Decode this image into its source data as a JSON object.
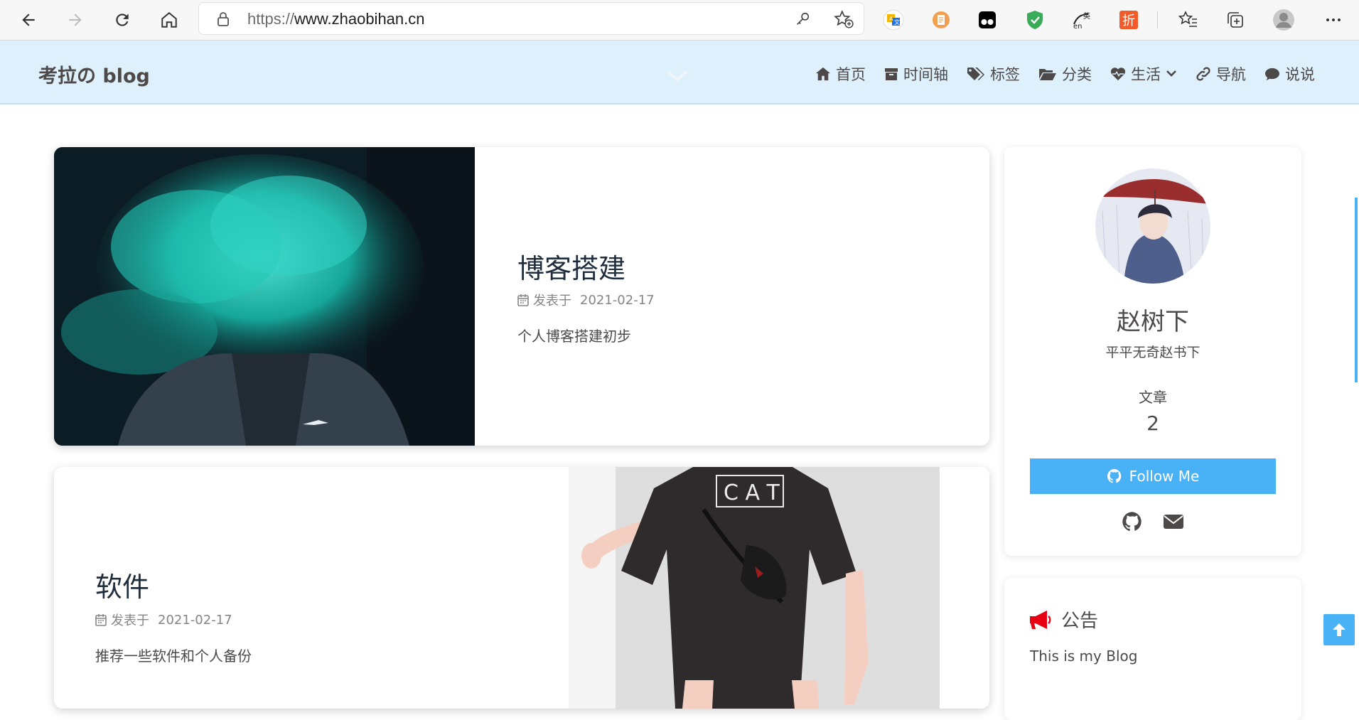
{
  "browser": {
    "url_scheme": "https://",
    "url_host": "www.zhaobihan.cn",
    "extensions": [
      "translate-icon",
      "document-icon",
      "tampermonkey-icon",
      "shield-icon",
      "dictionary-icon",
      "discount-icon"
    ],
    "ext_discount_label": "折"
  },
  "site": {
    "title": "考拉の blog",
    "menu": [
      {
        "icon": "home-icon",
        "label": "首页"
      },
      {
        "icon": "archive-icon",
        "label": "时间轴"
      },
      {
        "icon": "tags-icon",
        "label": "标签"
      },
      {
        "icon": "folder-icon",
        "label": "分类"
      },
      {
        "icon": "heart-icon",
        "label": "生活"
      },
      {
        "icon": "link-icon",
        "label": "导航"
      },
      {
        "icon": "comment-icon",
        "label": "说说"
      }
    ]
  },
  "posts": [
    {
      "title": "博客搭建",
      "meta_label": "发表于",
      "date": "2021-02-17",
      "excerpt": "个人博客搭建初步"
    },
    {
      "title": "软件",
      "meta_label": "发表于",
      "date": "2021-02-17",
      "excerpt": "推荐一些软件和个人备份"
    }
  ],
  "profile": {
    "name": "赵树下",
    "motto": "平平无奇赵书下",
    "stat_label": "文章",
    "stat_value": "2",
    "follow_label": "Follow Me"
  },
  "announcement": {
    "title": "公告",
    "text": "This is my Blog"
  },
  "colors": {
    "accent": "#49b1f5",
    "header_bg": "#dff0fd",
    "announce_icon": "#e60012"
  }
}
